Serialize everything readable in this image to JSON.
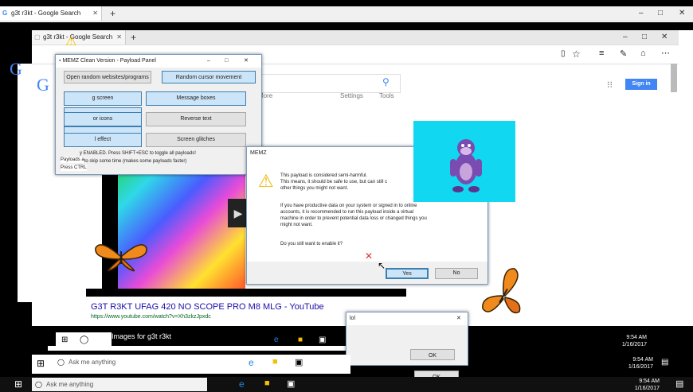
{
  "browser1": {
    "tab_title": "g3t r3kt - Google Search",
    "minimize": "–",
    "maximize": "□",
    "close": "✕"
  },
  "browser2": {
    "tab_title": "g3t r3kt - Google Search",
    "sign_in": "Sign in",
    "more": "More",
    "settings": "Settings",
    "tools": "Tools"
  },
  "memz_panel": {
    "title": "MEMZ Clean Version - Payload Panel",
    "buttons": {
      "open_websites": "Open random websites/programs",
      "cursor": "Random cursor movement",
      "screen": "g screen",
      "message_boxes": "Message boxes",
      "icons": "or icons",
      "reverse_text": "Reverse text",
      "effect": "l effect",
      "screen_glitches": "Screen glitches"
    },
    "status1": "y ENABLED. Press SHIFT+ESC to toggle all payloads!",
    "status2": "S to skip some time (makes some payloads faster)",
    "side1": "Payloads a",
    "side2": "Press CTRL"
  },
  "memz_dialog": {
    "title": "MEMZ",
    "line1": "This payload is considered semi-harmful.",
    "line2": "This means, it should be safe to use, but can still c",
    "line3": "other things you might not want.",
    "line4": "If you have productive data on your system or signed in to online",
    "line5": "accounts, it is recommended to run this payload inside a virtual",
    "line6": "machine in order to prevent potential data loss or changed things you",
    "line7": "might not want.",
    "question": "Do you still want to enable it?",
    "yes": "Yes",
    "no": "No"
  },
  "search_result": {
    "title": "G3T R3KT UFAG 420 NO SCOPE PRO M8 MLG - YouTube",
    "url": "https://www.youtube.com/watch?v=Xh3zkzJpxdc",
    "images": "Images for g3t r3kt"
  },
  "small_dialog": {
    "title": "lol",
    "ok": "OK",
    "ok2": "OK"
  },
  "taskbar": {
    "search_placeholder": "Ask me anything",
    "time": "9:54 AM",
    "date": "1/16/2017"
  },
  "colors": {
    "accent": "#4285f4",
    "sign_in": "#4285f4",
    "bonzi_bg": "#11d8f0",
    "link": "#1a0dab",
    "url_green": "#006621"
  }
}
